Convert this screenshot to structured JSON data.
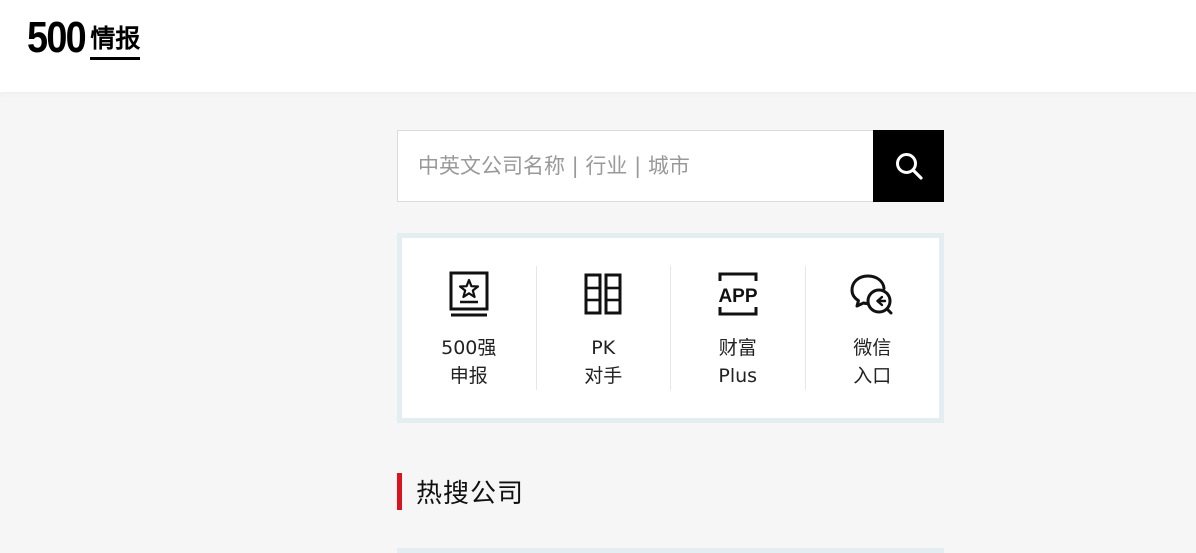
{
  "header": {
    "logo_number": "500",
    "logo_text": "情报"
  },
  "search": {
    "placeholder": "中英文公司名称 | 行业 | 城市",
    "value": "",
    "button_icon": "search-icon"
  },
  "quick_links": [
    {
      "icon": "ranking-report-icon",
      "line1": "500强",
      "line2": "申报"
    },
    {
      "icon": "compare-icon",
      "line1": "PK",
      "line2": "对手"
    },
    {
      "icon": "app-icon",
      "line1": "财富",
      "line2": "Plus"
    },
    {
      "icon": "wechat-icon",
      "line1": "微信",
      "line2": "入口"
    }
  ],
  "hot_search": {
    "title": "热搜公司"
  },
  "colors": {
    "accent": "#d7141f",
    "panel_border": "#e2eef0",
    "search_button": "#000000",
    "page_background": "#f6f6f6"
  }
}
